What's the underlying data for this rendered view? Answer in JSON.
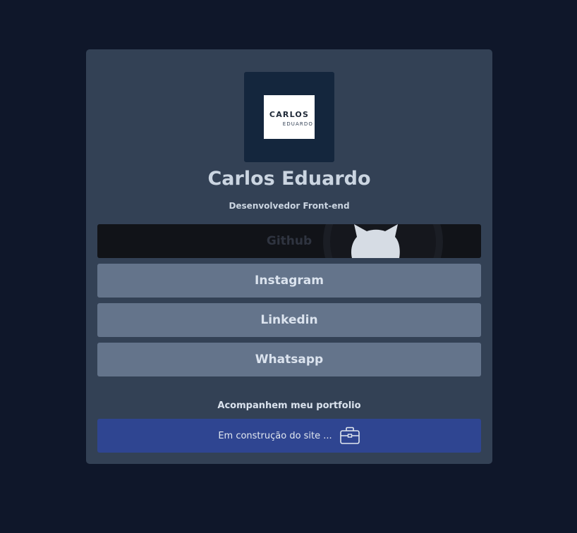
{
  "profile": {
    "logo_main": "CARLOS",
    "logo_sub": "EDUARDO",
    "name": "Carlos Eduardo",
    "role": "Desenvolvedor Front-end"
  },
  "links": [
    {
      "label": "Github"
    },
    {
      "label": "Instagram"
    },
    {
      "label": "Linkedin"
    },
    {
      "label": "Whatsapp"
    }
  ],
  "portfolio": {
    "title": "Acompanhem meu portfolio",
    "button_label": "Em construção do site ...",
    "icon": "briefcase-icon"
  },
  "colors": {
    "background": "#0f172a",
    "card": "#334155",
    "button": "#64748b",
    "portfolio_button": "#2f4591",
    "github_button": "#111318"
  }
}
